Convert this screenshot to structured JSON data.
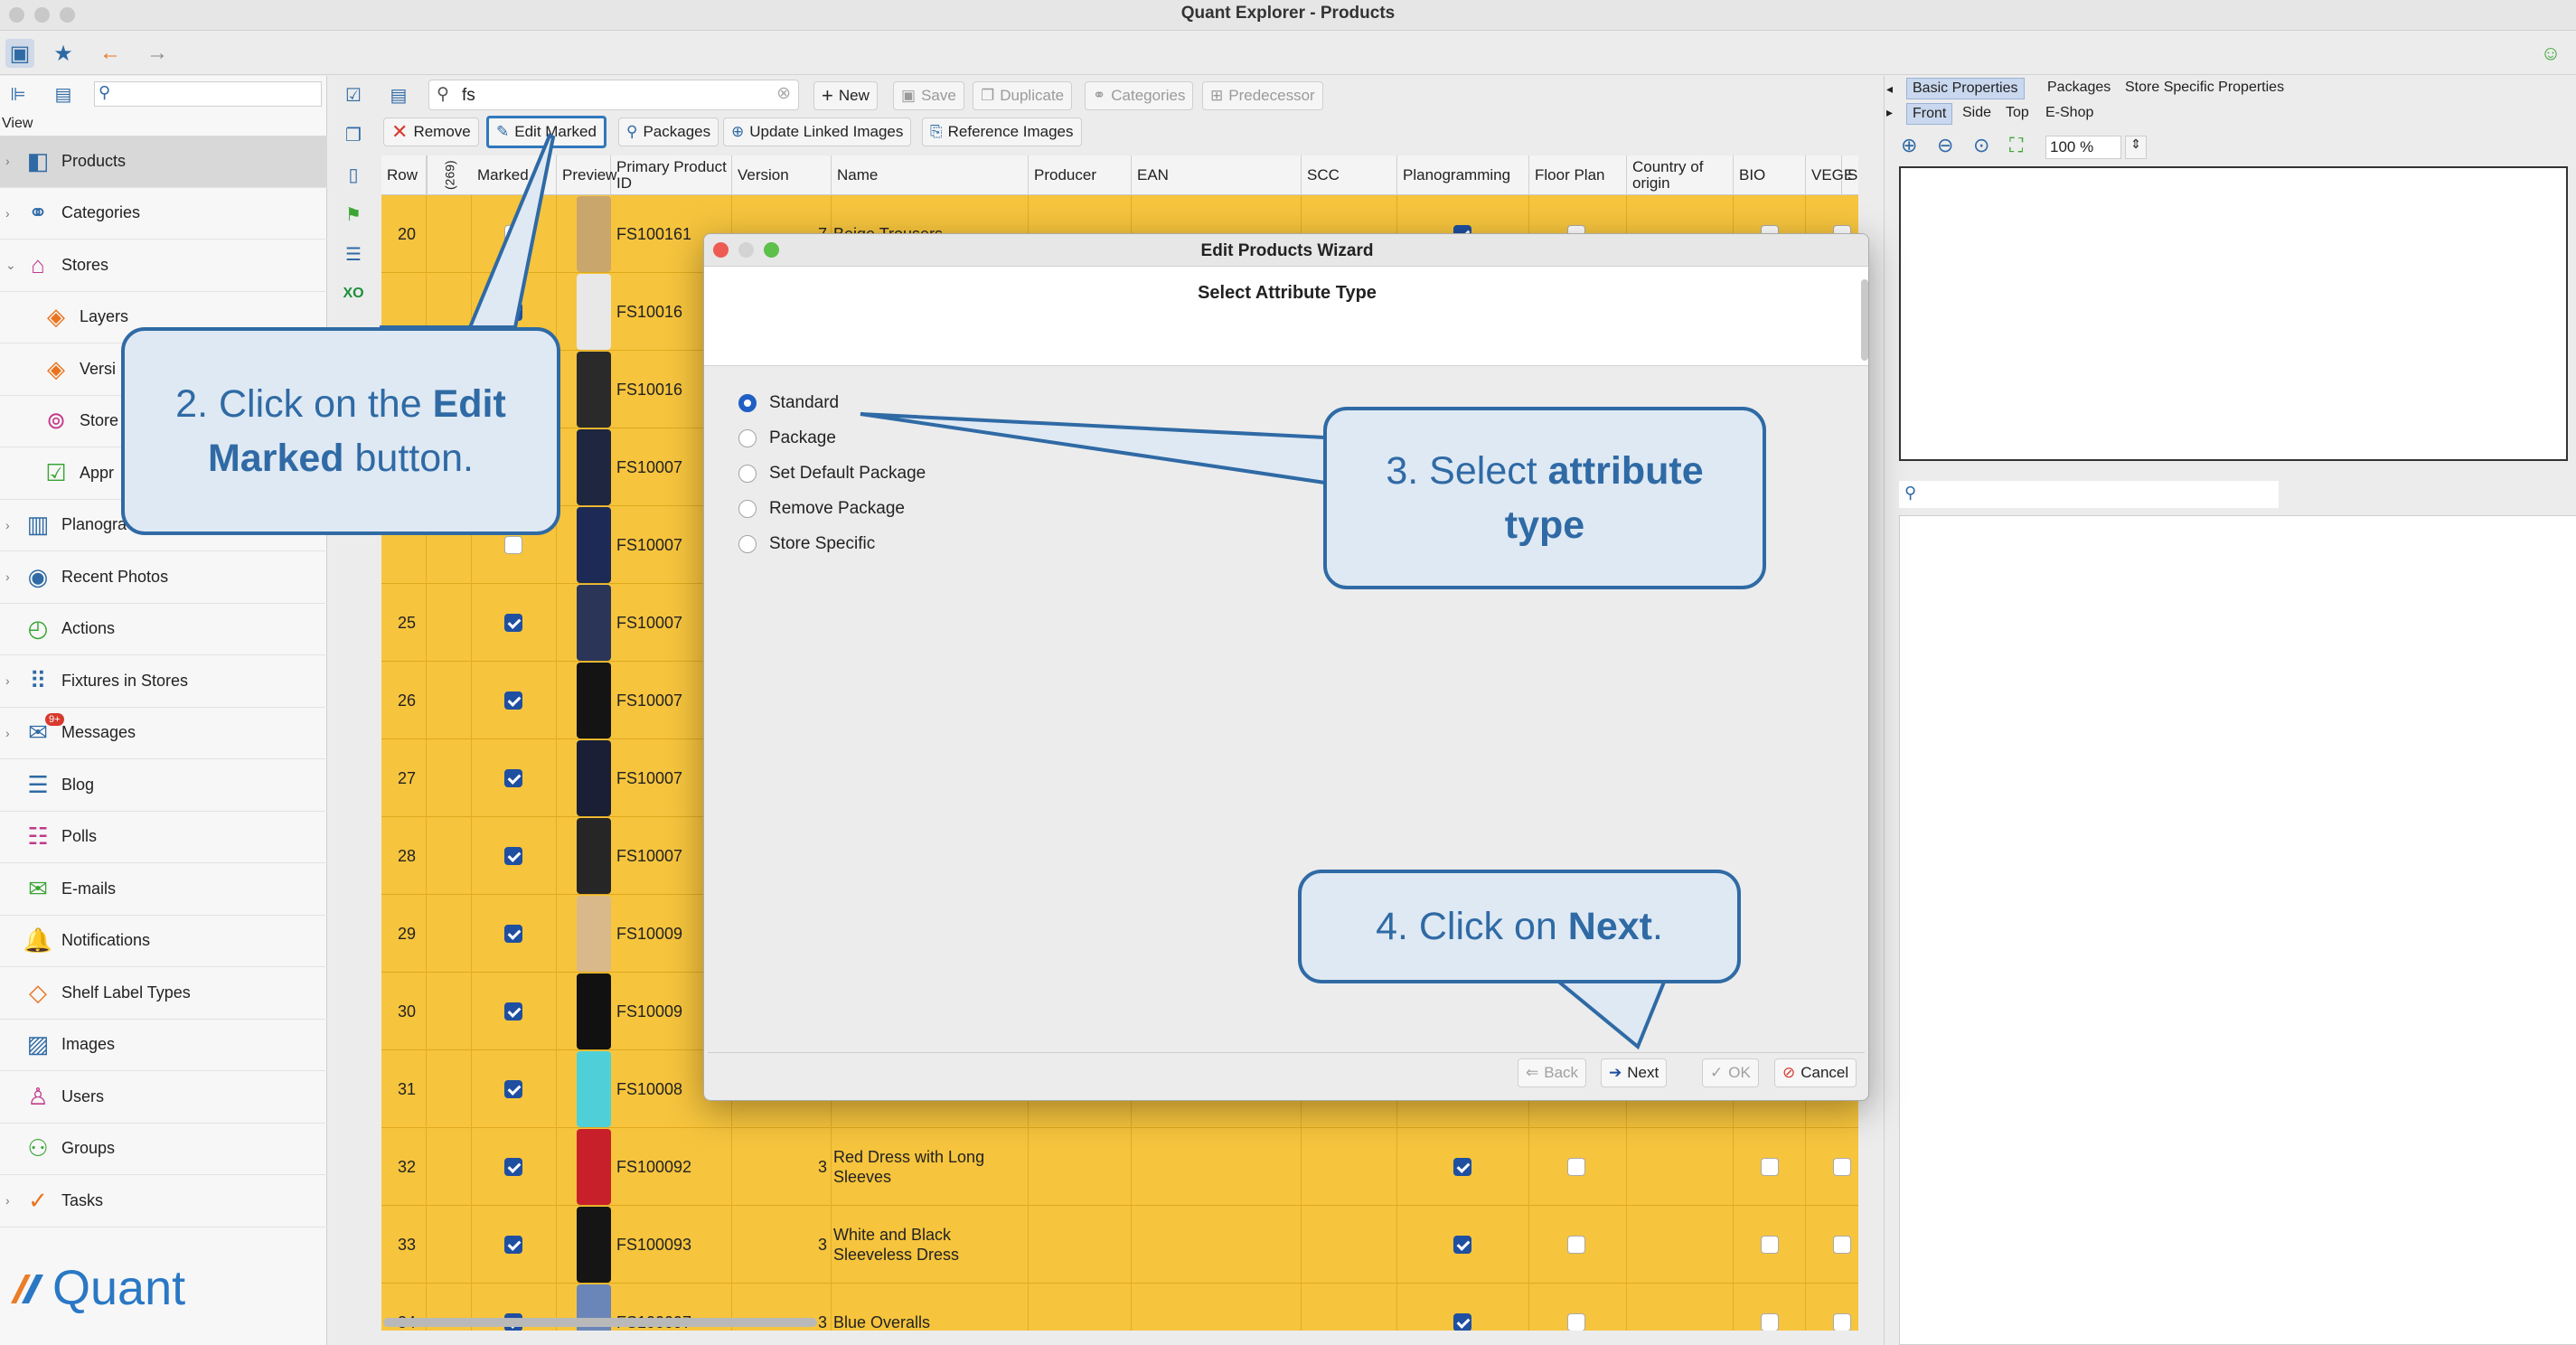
{
  "window": {
    "title": "Quant Explorer - Products"
  },
  "sidebar": {
    "view_label": "View",
    "items": [
      {
        "label": "Products",
        "icon": "products-icon",
        "selected": true,
        "expandable": true
      },
      {
        "label": "Categories",
        "icon": "categories-icon",
        "expandable": true
      },
      {
        "label": "Stores",
        "icon": "stores-icon",
        "expandable": true,
        "expanded": true
      },
      {
        "label": "Layers",
        "icon": "layers-icon",
        "sub": true
      },
      {
        "label": "Versi",
        "icon": "versions-icon",
        "sub": true
      },
      {
        "label": "Store",
        "icon": "store-icon",
        "sub": true
      },
      {
        "label": "Appr",
        "icon": "approvals-icon",
        "sub": true
      },
      {
        "label": "Planogra",
        "icon": "planogram-icon",
        "expandable": true
      },
      {
        "label": "Recent Photos",
        "icon": "camera-icon",
        "expandable": true
      },
      {
        "label": "Actions",
        "icon": "actions-icon"
      },
      {
        "label": "Fixtures in Stores",
        "icon": "fixtures-icon",
        "expandable": true
      },
      {
        "label": "Messages",
        "icon": "messages-icon",
        "expandable": true,
        "badge": "9+"
      },
      {
        "label": "Blog",
        "icon": "blog-icon"
      },
      {
        "label": "Polls",
        "icon": "polls-icon"
      },
      {
        "label": "E-mails",
        "icon": "email-icon"
      },
      {
        "label": "Notifications",
        "icon": "bell-icon"
      },
      {
        "label": "Shelf Label Types",
        "icon": "shelf-label-icon"
      },
      {
        "label": "Images",
        "icon": "images-icon"
      },
      {
        "label": "Users",
        "icon": "users-icon"
      },
      {
        "label": "Groups",
        "icon": "groups-icon"
      },
      {
        "label": "Tasks",
        "icon": "tasks-icon",
        "expandable": true
      }
    ],
    "logo_text": "Quant"
  },
  "toolbar": {
    "search_value": "fs",
    "new": "New",
    "save": "Save",
    "duplicate": "Duplicate",
    "categories": "Categories",
    "predecessor": "Predecessor",
    "remove": "Remove",
    "edit_marked": "Edit Marked",
    "packages": "Packages",
    "update_linked_images": "Update Linked Images",
    "reference_images": "Reference Images"
  },
  "table": {
    "columns": [
      "Row",
      "(269)",
      "Marked",
      "Preview",
      "Primary Product ID",
      "Version",
      "Name",
      "Producer",
      "EAN",
      "SCC",
      "Planogramming",
      "Floor Plan",
      "Country of origin",
      "BIO",
      "VEGE",
      "SE"
    ],
    "rows": [
      {
        "row": "20",
        "marked": false,
        "preview": "#c9a66b",
        "id": "FS100161",
        "version": "7",
        "name": "Beige Trousers",
        "plano": true
      },
      {
        "row": "",
        "marked": true,
        "preview": "#e8e8e8",
        "id": "FS10016",
        "version": "",
        "name": "",
        "plano": false
      },
      {
        "row": "",
        "marked": false,
        "preview": "#2a2a2a",
        "id": "FS10016",
        "version": "",
        "name": "",
        "plano": false
      },
      {
        "row": "",
        "marked": false,
        "preview": "#1e2640",
        "id": "FS10007",
        "version": "",
        "name": "",
        "plano": false
      },
      {
        "row": "",
        "marked": false,
        "preview": "#1c2a55",
        "id": "FS10007",
        "version": "",
        "name": "",
        "plano": false
      },
      {
        "row": "25",
        "marked": true,
        "preview": "#2b3558",
        "id": "FS10007",
        "version": "",
        "name": "",
        "plano": false
      },
      {
        "row": "26",
        "marked": true,
        "preview": "#141414",
        "id": "FS10007",
        "version": "",
        "name": "",
        "plano": false
      },
      {
        "row": "27",
        "marked": true,
        "preview": "#1a1f36",
        "id": "FS10007",
        "version": "",
        "name": "",
        "plano": false
      },
      {
        "row": "28",
        "marked": true,
        "preview": "#262626",
        "id": "FS10007",
        "version": "",
        "name": "",
        "plano": false
      },
      {
        "row": "29",
        "marked": true,
        "preview": "#d9b98a",
        "id": "FS10009",
        "version": "",
        "name": "",
        "plano": false
      },
      {
        "row": "30",
        "marked": true,
        "preview": "#111111",
        "id": "FS10009",
        "version": "",
        "name": "",
        "plano": false
      },
      {
        "row": "31",
        "marked": true,
        "preview": "#4fd0d8",
        "id": "FS10008",
        "version": "",
        "name": "",
        "plano": false
      },
      {
        "row": "32",
        "marked": true,
        "preview": "#c8202a",
        "id": "FS100092",
        "version": "3",
        "name": "Red Dress with Long Sleeves",
        "plano": true
      },
      {
        "row": "33",
        "marked": true,
        "preview": "#151515",
        "id": "FS100093",
        "version": "3",
        "name": "White and Black Sleeveless Dress",
        "plano": true
      },
      {
        "row": "34",
        "marked": true,
        "preview": "#6a86b8",
        "id": "FS100097",
        "version": "3",
        "name": "Blue Overalls",
        "plano": true
      }
    ]
  },
  "right_panel": {
    "tabs": [
      "Basic Properties",
      "Packages",
      "Store Specific Properties"
    ],
    "view_tabs": [
      "Front",
      "Side",
      "Top",
      "E-Shop"
    ],
    "zoom": "100 %"
  },
  "dialog": {
    "title": "Edit Products Wizard",
    "heading": "Select Attribute Type",
    "options": [
      "Standard",
      "Package",
      "Set Default Package",
      "Remove Package",
      "Store Specific"
    ],
    "selected": 0,
    "back": "Back",
    "next": "Next",
    "ok": "OK",
    "cancel": "Cancel"
  },
  "callouts": {
    "c2": {
      "pre": "2. Click on the ",
      "bold": "Edit Marked",
      "post": " button."
    },
    "c3": {
      "pre": "3. Select ",
      "bold": "attribute type",
      "post": ""
    },
    "c4": {
      "pre": "4. Click on ",
      "bold": "Next",
      "post": "."
    }
  },
  "colors": {
    "row_bg": "#f6c43d",
    "accent": "#2f6aa5",
    "check": "#1f4fa0"
  }
}
